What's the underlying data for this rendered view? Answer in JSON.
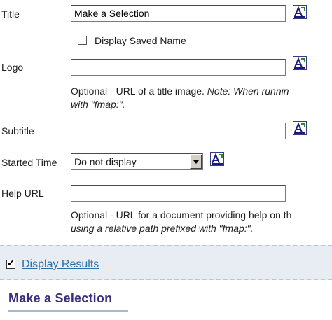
{
  "form": {
    "title": {
      "label": "Title",
      "value": "Make a Selection"
    },
    "display_saved_name": {
      "label": "Display Saved Name",
      "checked": false
    },
    "logo": {
      "label": "Logo",
      "value": "",
      "help_plain": "Optional - URL of a title image. ",
      "help_italic_1": "Note: When runnin",
      "help_italic_2": "with \"fmap:\"."
    },
    "subtitle": {
      "label": "Subtitle",
      "value": ""
    },
    "started_time": {
      "label": "Started Time",
      "selected": "Do not display"
    },
    "help_url": {
      "label": "Help URL",
      "value": "",
      "help_line1": "Optional - URL for a document providing help on th",
      "help_line2": "using a relative path prefixed with \"fmap:\"."
    }
  },
  "results": {
    "label": "Display Results",
    "checked": true
  },
  "preview": {
    "title": "Make a Selection"
  },
  "icons": {
    "edit": "text-format-icon"
  },
  "colors": {
    "link": "#2a6fa6",
    "preview_title": "#3a2f7a",
    "panel_bg": "#e8edf3"
  }
}
